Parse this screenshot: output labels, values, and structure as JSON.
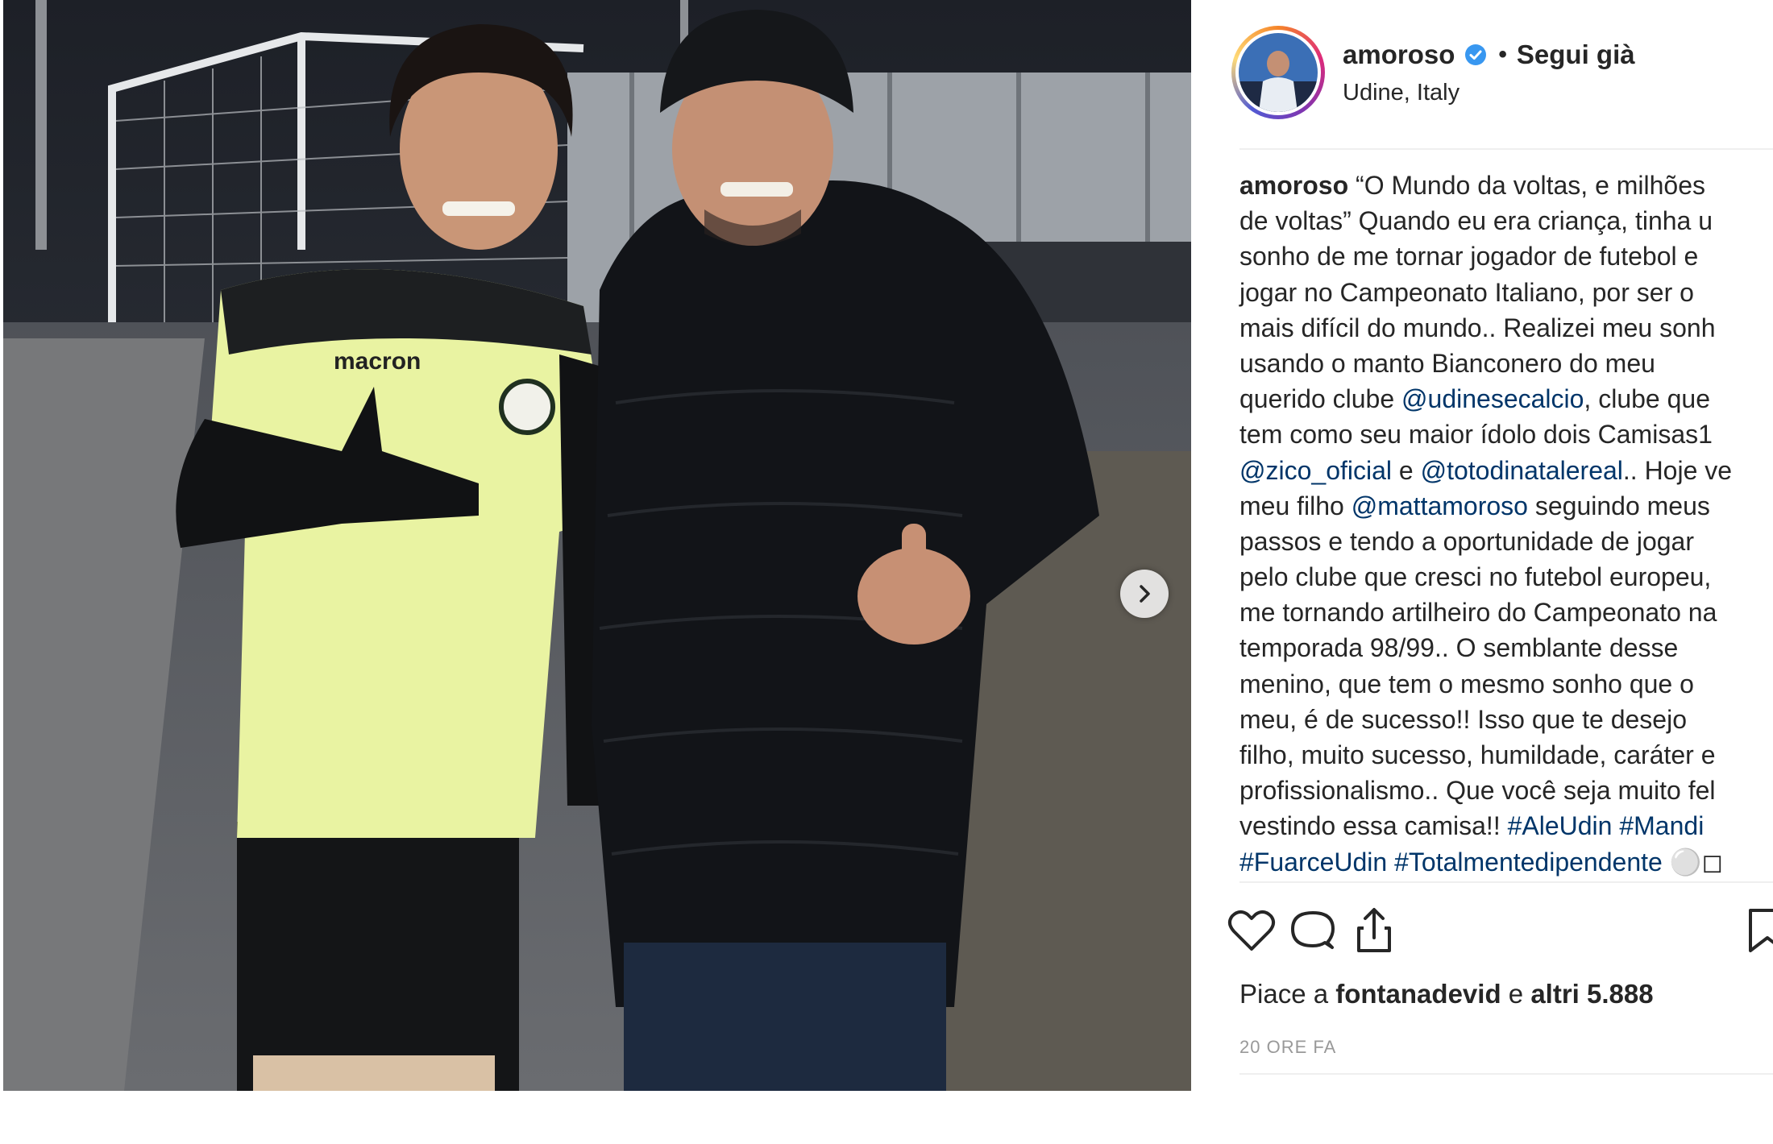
{
  "post": {
    "username": "amoroso",
    "separator": "•",
    "follow_label": "Segui già",
    "location": "Udine, Italy",
    "caption_lines": [
      {
        "parts": [
          {
            "t": "amoroso",
            "k": "user"
          },
          {
            "t": " “O Mundo da voltas, e milhões",
            "k": "text"
          }
        ]
      },
      {
        "parts": [
          {
            "t": "de voltas” Quando eu era criança, tinha u",
            "k": "text"
          }
        ]
      },
      {
        "parts": [
          {
            "t": "sonho de me tornar jogador de futebol e",
            "k": "text"
          }
        ]
      },
      {
        "parts": [
          {
            "t": "jogar no Campeonato Italiano, por ser o",
            "k": "text"
          }
        ]
      },
      {
        "parts": [
          {
            "t": "mais difícil do mundo.. Realizei meu sonh",
            "k": "text"
          }
        ]
      },
      {
        "parts": [
          {
            "t": "usando o manto Bianconero do meu",
            "k": "text"
          }
        ]
      },
      {
        "parts": [
          {
            "t": "querido clube ",
            "k": "text"
          },
          {
            "t": "@udinesecalcio",
            "k": "link"
          },
          {
            "t": ", clube que",
            "k": "text"
          }
        ]
      },
      {
        "parts": [
          {
            "t": "tem como seu maior ídolo dois Camisas1",
            "k": "text"
          }
        ]
      },
      {
        "parts": [
          {
            "t": "@zico_oficial",
            "k": "link"
          },
          {
            "t": " e ",
            "k": "text"
          },
          {
            "t": "@totodinatalereal",
            "k": "link"
          },
          {
            "t": ".. Hoje ve",
            "k": "text"
          }
        ]
      },
      {
        "parts": [
          {
            "t": "meu filho ",
            "k": "text"
          },
          {
            "t": "@mattamoroso",
            "k": "link"
          },
          {
            "t": " seguindo meus",
            "k": "text"
          }
        ]
      },
      {
        "parts": [
          {
            "t": "passos e tendo a oportunidade de jogar",
            "k": "text"
          }
        ]
      },
      {
        "parts": [
          {
            "t": "pelo clube que cresci no futebol europeu,",
            "k": "text"
          }
        ]
      },
      {
        "parts": [
          {
            "t": "me tornando artilheiro do Campeonato na",
            "k": "text"
          }
        ]
      },
      {
        "parts": [
          {
            "t": "temporada 98/99.. O semblante desse",
            "k": "text"
          }
        ]
      },
      {
        "parts": [
          {
            "t": "menino, que tem o mesmo sonho que o",
            "k": "text"
          }
        ]
      },
      {
        "parts": [
          {
            "t": "meu, é de sucesso!! Isso que te desejo",
            "k": "text"
          }
        ]
      },
      {
        "parts": [
          {
            "t": "filho, muito sucesso, humildade, caráter e",
            "k": "text"
          }
        ]
      },
      {
        "parts": [
          {
            "t": "profissionalismo.. Que você seja muito fel",
            "k": "text"
          }
        ]
      },
      {
        "parts": [
          {
            "t": "vestindo essa camisa!! ",
            "k": "text"
          },
          {
            "t": "#AleUdin",
            "k": "link"
          },
          {
            "t": " ",
            "k": "text"
          },
          {
            "t": "#Mandi",
            "k": "link"
          }
        ]
      },
      {
        "parts": [
          {
            "t": "#FuarceUdin",
            "k": "link"
          },
          {
            "t": " ",
            "k": "text"
          },
          {
            "t": "#Totalmentedipendente",
            "k": "link"
          },
          {
            "t": " ⚪◻",
            "k": "text"
          }
        ]
      }
    ],
    "likes": {
      "prefix": "Piace a ",
      "user": "fontanadevid",
      "conj": " e ",
      "others": "altri 5.888"
    },
    "timestamp": "20 ORE FA"
  },
  "icons": {
    "verified": "verified-badge-icon",
    "like": "heart-icon",
    "comment": "comment-icon",
    "share": "share-icon",
    "save": "bookmark-icon",
    "next": "chevron-right-icon"
  },
  "colors": {
    "link": "#003569",
    "verified": "#3897f0",
    "muted": "#999999",
    "text": "#262626"
  }
}
